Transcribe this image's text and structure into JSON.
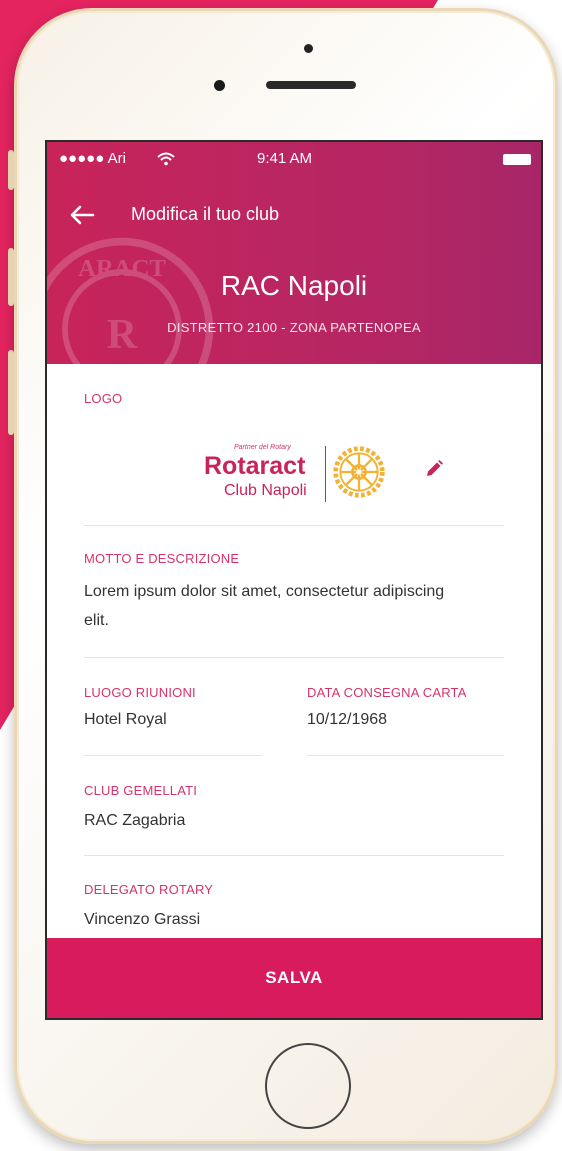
{
  "colors": {
    "accent": "#d81b5c",
    "header": "#c8245a",
    "label": "#d6336c"
  },
  "status_bar": {
    "carrier": "●●●●● Ari",
    "time": "9:41 AM"
  },
  "nav": {
    "title": "Modifica il tuo club",
    "back_icon": "arrow-left-icon"
  },
  "header": {
    "club_name": "RAC Napoli",
    "subtitle": "DISTRETTO 2100 - ZONA PARTENOPEA"
  },
  "logo": {
    "label": "LOGO",
    "partner_text": "Partner del Rotary",
    "brand": "Rotaract",
    "club": "Club Napoli",
    "edit_icon": "pencil-icon"
  },
  "motto": {
    "label": "MOTTO E DESCRIZIONE",
    "line1": "Lorem ipsum dolor sit amet, consectetur adipiscing",
    "line2": "elit."
  },
  "meeting_place": {
    "label": "LUOGO RIUNIONI",
    "value": "Hotel Royal"
  },
  "charter_date": {
    "label": "DATA CONSEGNA CARTA",
    "value": "10/12/1968"
  },
  "twin_clubs": {
    "label": "CLUB GEMELLATI",
    "value": "RAC Zagabria"
  },
  "rotary_delegate": {
    "label": "DELEGATO ROTARY",
    "value": "Vincenzo Grassi"
  },
  "save_button": {
    "label": "SALVA"
  }
}
